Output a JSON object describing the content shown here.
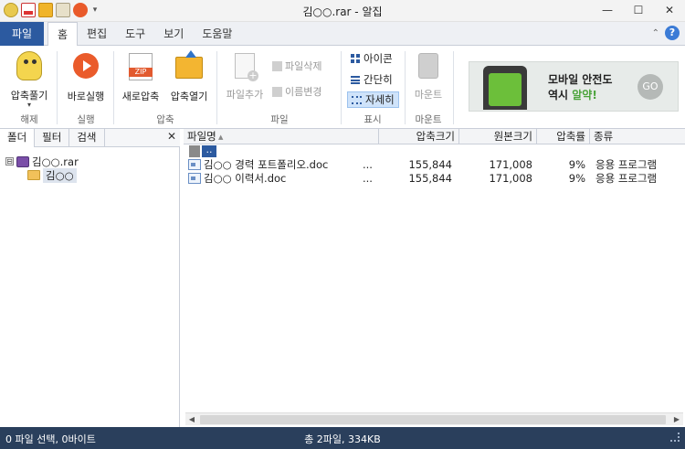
{
  "window": {
    "title": "김○○.rar - 알집",
    "min": "—",
    "max": "☐",
    "close": "✕"
  },
  "quick_access": {
    "dropdown": "▾"
  },
  "ribbon_tabs": {
    "file": "파일",
    "tabs": [
      "홈",
      "편집",
      "도구",
      "보기",
      "도움말"
    ],
    "collapse": "⌃",
    "help": "?"
  },
  "ribbon": {
    "extract": {
      "label": "압축풀기",
      "sub": "▾"
    },
    "run": "바로실행",
    "new_archive": "새로압축",
    "open_archive": "압축열기",
    "add_file": "파일추가",
    "delete_file": "파일삭제",
    "rename": "이름변경",
    "view_icon": "아이콘",
    "view_simple": "간단히",
    "view_detail": "자세히",
    "mount": "마운트",
    "groups": {
      "extract": "해제",
      "run": "실행",
      "compress": "압축",
      "file": "파일",
      "display": "표시",
      "mount": "마운트"
    }
  },
  "ad": {
    "line1": "모바일 안전도",
    "line2_prefix": "역시 ",
    "line2_accent": "알약!",
    "go": "GO"
  },
  "left_panel": {
    "tabs": [
      "폴더",
      "필터",
      "검색"
    ],
    "close": "✕",
    "tree": {
      "root": "김○○.rar",
      "root_toggle": "⊟",
      "child": "김○○"
    }
  },
  "file_list": {
    "columns": [
      "파일명",
      "압축크기",
      "원본크기",
      "압축률",
      "종류"
    ],
    "up_row": "..",
    "rows": [
      {
        "name": "김○○ 경력 포트폴리오.doc",
        "ellipsis": "...",
        "packed": "155,844",
        "original": "171,008",
        "ratio": "9%",
        "type": "응용 프로그램"
      },
      {
        "name": "김○○ 이력서.doc",
        "ellipsis": "...",
        "packed": "155,844",
        "original": "171,008",
        "ratio": "9%",
        "type": "응용 프로그램"
      }
    ]
  },
  "scroll": {
    "left": "◀",
    "right": "▶"
  },
  "status": {
    "left": "0 파일 선택, 0바이트",
    "center": "총 2파일, 334KB"
  },
  "colors": {
    "file_tab": "#2c5aa0",
    "status_bar": "#2a3f5c",
    "ad_accent": "#4aa33a"
  }
}
